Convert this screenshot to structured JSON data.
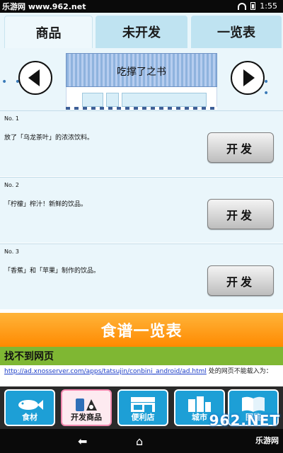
{
  "status_bar": {
    "watermark": "乐游网 www.962.net",
    "time": "1:55"
  },
  "tabs": [
    {
      "label": "商品"
    },
    {
      "label": "未开发"
    },
    {
      "label": "一览表"
    }
  ],
  "header": {
    "shop_sign": "吃撑了之书",
    "dots": "• •"
  },
  "products": [
    {
      "no": "No. 1",
      "desc": "放了「乌龙茶叶」的浓浓饮料。",
      "button": "开发"
    },
    {
      "no": "No. 2",
      "desc": "「柠檬」榨汁！新鲜的饮品。",
      "button": "开发"
    },
    {
      "no": "No. 3",
      "desc": "「香蕉」和「苹果」制作的饮品。",
      "button": "开发"
    }
  ],
  "recipe_banner": "食谱一览表",
  "ad": {
    "title": "找不到网页",
    "link": "http://ad.xnosserver.com/apps/tatsujin/conbini_android/ad.html",
    "text": " 处的网页不能载入为："
  },
  "bottom_nav": [
    {
      "label": "食材",
      "icon": "fish-icon"
    },
    {
      "label": "开发商品",
      "icon": "product-icon"
    },
    {
      "label": "便利店",
      "icon": "store-icon"
    },
    {
      "label": "城市",
      "icon": "city-icon"
    },
    {
      "label": "图鉴",
      "icon": "book-icon"
    }
  ],
  "watermark_br": "962.NET",
  "watermark_br2": "乐游网",
  "colors": {
    "accent_orange": "#ff8a00",
    "nav_blue": "#1d9fd6",
    "bg_light": "#eaf6fb",
    "ad_green": "#7fb733"
  }
}
